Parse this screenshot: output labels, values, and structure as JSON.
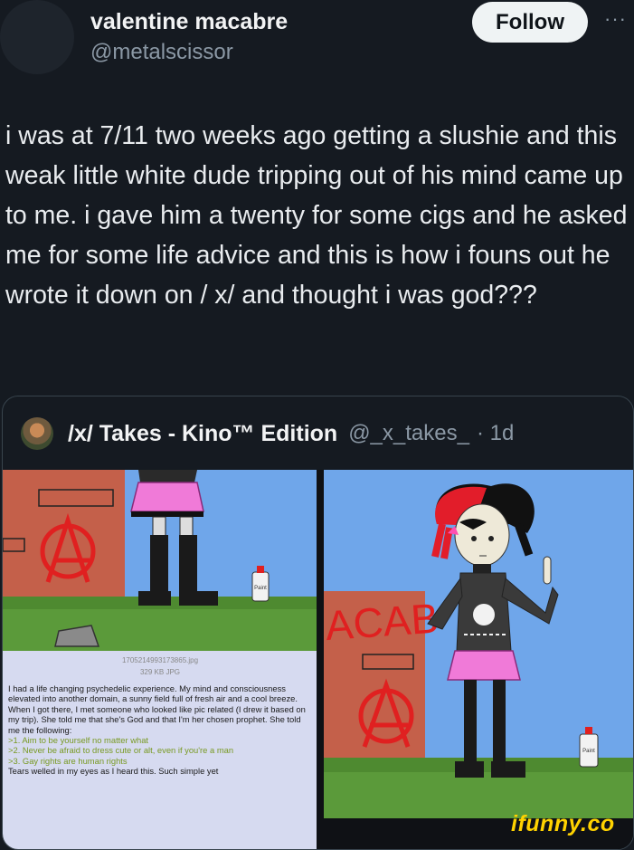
{
  "header": {
    "display_name": "valentine macabre",
    "handle": "@metalscissor",
    "follow_label": "Follow",
    "more_label": "···"
  },
  "tweet": {
    "text": "i was at 7/11 two weeks ago getting a slushie and this weak little white dude tripping out of his mind came up to me. i gave him a twenty for some cigs and he asked me for some life advice and this is how i founs out he wrote it down on / x/ and thought i was god???"
  },
  "quote": {
    "name": "/x/ Takes - Kino™ Edition",
    "handle": "@_x_takes_",
    "time": "· 1d"
  },
  "image_left": {
    "filename": "1705214993173865.jpg",
    "filesize": "329 KB JPG",
    "paint_label": "Paint",
    "post_text": "I had a life changing psychedelic experience. My mind and consciousness elevated into another domain, a sunny field full of fresh air and a cool breeze. When I got there, I met someone who looked like pic related (I drew it based on my trip). She told me that she's God and that I'm her chosen prophet. She told me the following:",
    "greentext": [
      ">1. Aim to be yourself no matter what",
      ">2. Never be afraid to dress cute or alt, even if you're a man",
      ">3. Gay rights are human rights"
    ],
    "trailing": "Tears welled in my eyes as I heard this. Such simple yet"
  },
  "image_right": {
    "wall_text": "ACAB",
    "paint_label": "Paint"
  },
  "watermark": "ifunny.co",
  "colors": {
    "background": "#151a21",
    "secondary_text": "#8b98a5",
    "sky": "#6fa6ea",
    "grass": "#5b9a3a",
    "wall": "#c4604a",
    "anarchy_red": "#e02020",
    "skirt_pink": "#f07ad8",
    "greentext": "#789922",
    "watermark": "#ffd200"
  }
}
